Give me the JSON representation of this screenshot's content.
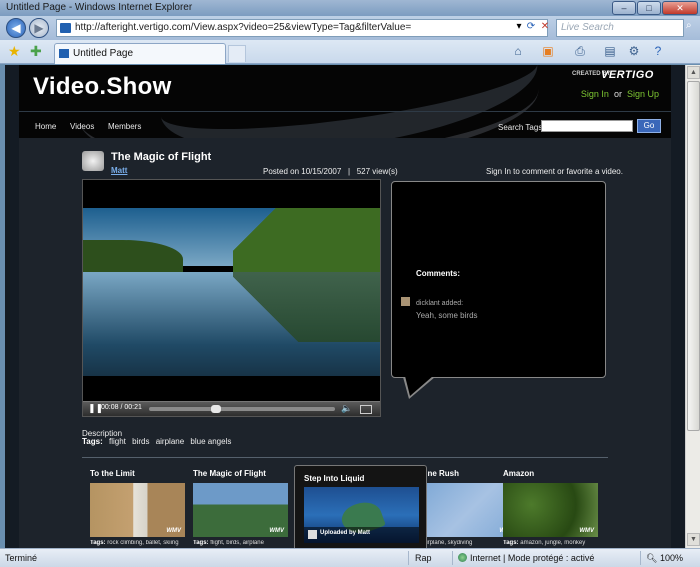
{
  "window": {
    "title": "Untitled Page - Windows Internet Explorer",
    "minimize": "–",
    "maximize": "□",
    "close": "✕"
  },
  "browser": {
    "url": "http://afteright.vertigo.com/View.aspx?video=25&viewType=Tag&filterValue=",
    "search_placeholder": "Live Search",
    "back_icon": "back-arrow-icon",
    "forward_icon": "forward-arrow-icon",
    "tab_title": "Untitled Page"
  },
  "site": {
    "logo": "Video.Show",
    "created_by": "CREATED BY",
    "brand": "VERTIGO",
    "sign_in": "Sign In",
    "or": "or",
    "sign_up": "Sign Up",
    "nav": [
      "Home",
      "Videos",
      "Members"
    ],
    "search_tags_label": "Search Tags",
    "go": "Go"
  },
  "video": {
    "title": "The Magic of Flight",
    "author": "Matt",
    "posted": "Posted on 10/15/2007",
    "sep": "|",
    "views": "527 view(s)",
    "sign_in_note": "Sign In to comment or favorite a video.",
    "time": "00:08 / 00:21",
    "progress": 0.35
  },
  "comments": {
    "title": "Comments:",
    "items": [
      {
        "author": "dicklant added:",
        "text": "Yeah, some birds"
      }
    ]
  },
  "description": {
    "label": "Description",
    "tags_label": "Tags:",
    "tags": [
      "flight",
      "birds",
      "airplane",
      "blue angels"
    ]
  },
  "related": [
    {
      "title": "To the Limit",
      "tags_label": "Tags:",
      "tags": "rock climbing, ballet, skiing"
    },
    {
      "title": "The Magic of Flight",
      "tags_label": "Tags:",
      "tags": "flight, birds, airplane"
    },
    {
      "title": "line Rush",
      "tags_label": "",
      "tags": "airplane, skydiving"
    },
    {
      "title": "Amazon",
      "tags_label": "Tags:",
      "tags": "amazon, jungle, monkey"
    }
  ],
  "featured": {
    "title": "Step Into Liquid",
    "uploaded": "Uploaded by Matt"
  },
  "watermark": "WMV",
  "status": {
    "left": "Terminé",
    "rap": "Rap",
    "zone": "Internet | Mode protégé : activé",
    "zoom": "100%"
  }
}
